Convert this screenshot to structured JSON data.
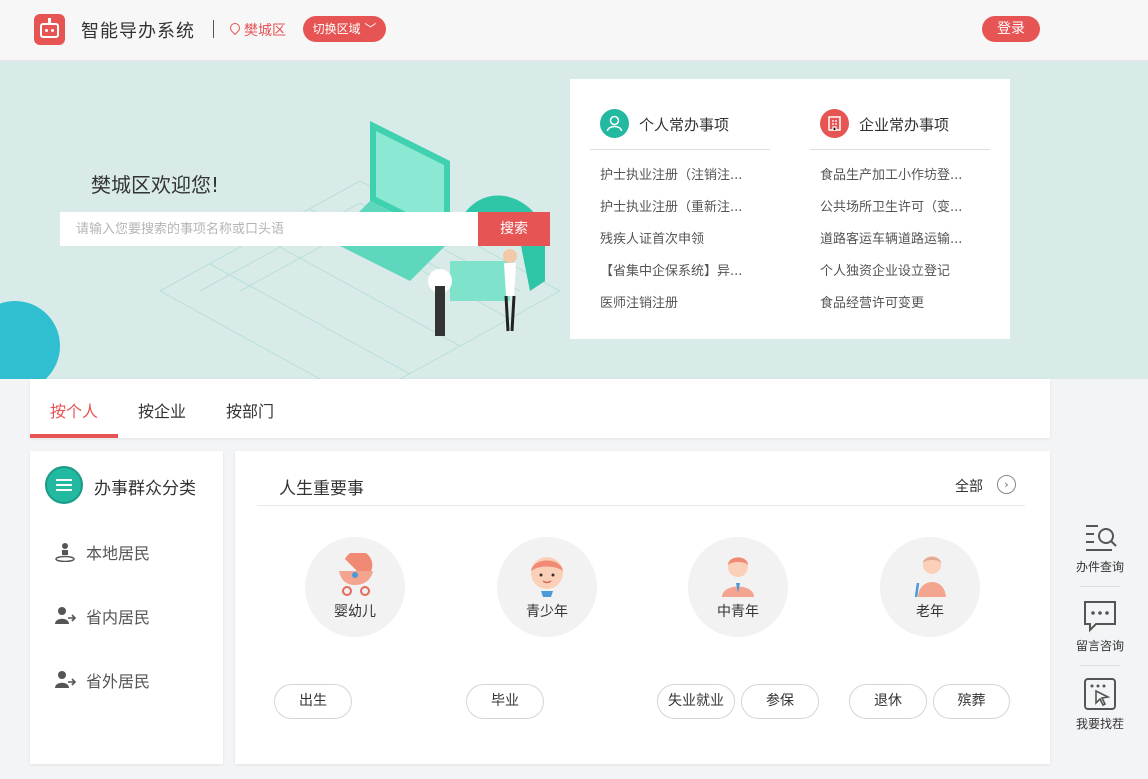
{
  "header": {
    "app_title": "智能导办系统",
    "region": "樊城区",
    "switch_label": "切换区域",
    "login_label": "登录"
  },
  "banner": {
    "welcome": "樊城区欢迎您!",
    "search_placeholder": "请输入您要搜索的事项名称或口头语",
    "search_button": "搜索"
  },
  "quick": {
    "personal": {
      "title": "个人常办事项",
      "items": [
        "护士执业注册（注销注...",
        "护士执业注册（重新注...",
        "残疾人证首次申领",
        "【省集中企保系统】异...",
        "医师注销注册"
      ]
    },
    "company": {
      "title": "企业常办事项",
      "items": [
        "食品生产加工小作坊登...",
        "公共场所卫生许可（变...",
        "道路客运车辆道路运输...",
        "个人独资企业设立登记",
        "食品经营许可变更"
      ]
    }
  },
  "tabs": [
    "按个人",
    "按企业",
    "按部门"
  ],
  "categories": {
    "title": "办事群众分类",
    "items": [
      "本地居民",
      "省内居民",
      "省外居民"
    ]
  },
  "life": {
    "title": "人生重要事",
    "all_label": "全部",
    "stages": [
      "婴幼儿",
      "青少年",
      "中青年",
      "老年"
    ],
    "events": [
      "出生",
      "毕业",
      "失业就业",
      "参保",
      "退休",
      "殡葬"
    ]
  },
  "tools": [
    "办件查询",
    "留言咨询",
    "我要找茬"
  ],
  "colors": {
    "accent": "#e65454",
    "teal": "#23b8a0"
  }
}
